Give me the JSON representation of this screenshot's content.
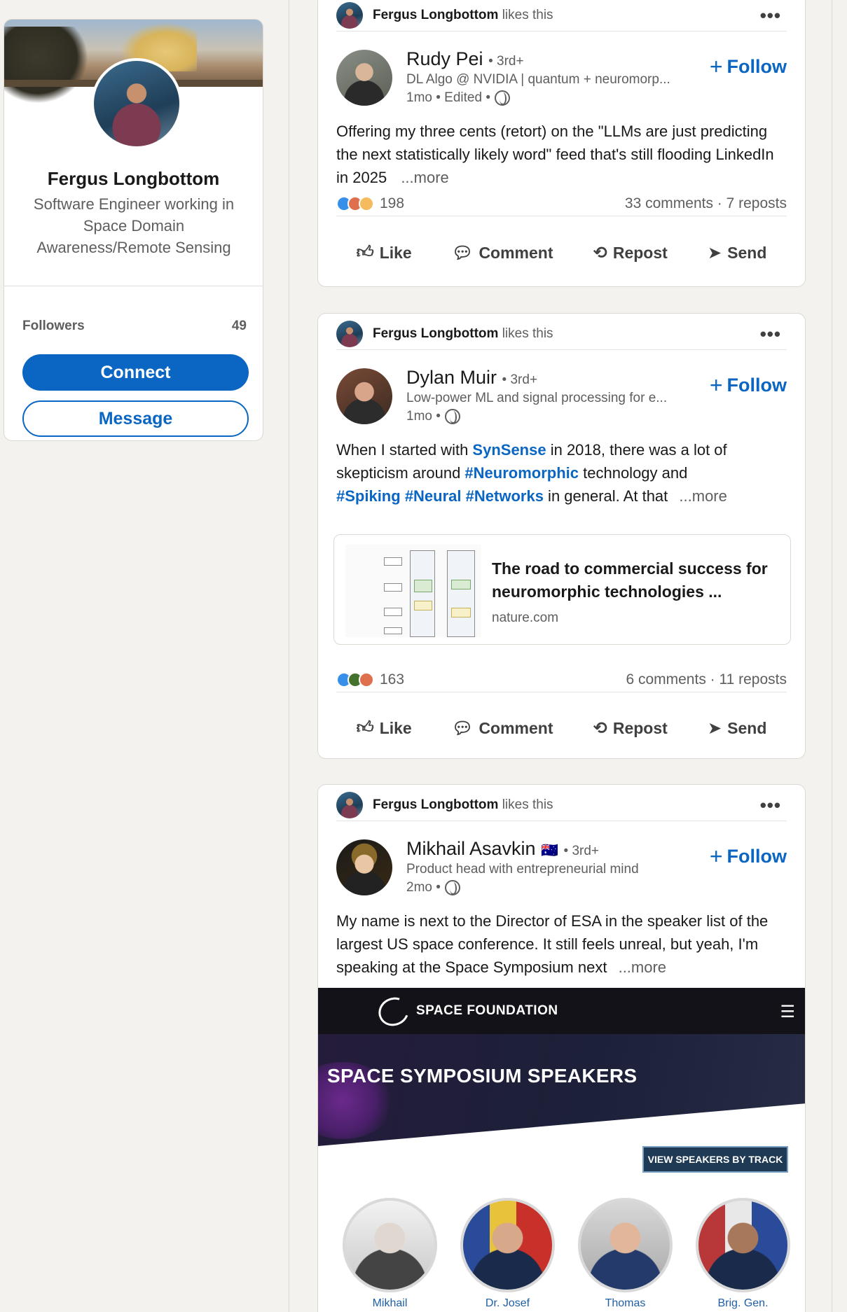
{
  "profile": {
    "name": "Fergus Longbottom",
    "headline": "Software Engineer working in Space Domain Awareness/Remote Sensing",
    "followers_label": "Followers",
    "followers_count": "49",
    "connect_label": "Connect",
    "message_label": "Message"
  },
  "common": {
    "likes_suffix": "likes this",
    "follow_label": "Follow",
    "follow_plus": "+",
    "more_icon": "more-horizontal-icon",
    "more_glyph": "•••",
    "actions": {
      "like": "Like",
      "comment": "Comment",
      "repost": "Repost",
      "send": "Send"
    }
  },
  "posts": [
    {
      "context_name": "Fergus Longbottom",
      "author_name": "Rudy Pei",
      "author_degree": "• 3rd+",
      "author_headline": "DL Algo @ NVIDIA | quantum + neuromorp...",
      "time": "1mo • Edited •",
      "text": "Offering my three cents (retort) on the \"LLMs are just predicting the next statistically likely word\" feed that's still flooding LinkedIn in 2025",
      "more": "...more",
      "reactions_count": "198",
      "comments_reposts": "33 comments · 7 reposts"
    },
    {
      "context_name": "Fergus Longbottom",
      "author_name": "Dylan Muir",
      "author_degree": "• 3rd+",
      "author_headline": "Low-power ML and signal processing for e...",
      "time": "1mo •",
      "text_parts": {
        "p1": "When I started with ",
        "link1": "SynSense",
        "p2": " in 2018, there was a lot of skepticism around ",
        "tag1": "#Neuromorphic",
        "p3": " technology and ",
        "tag2": "#Spiking",
        "tag3": "#Neural",
        "tag4": "#Networks",
        "p4": " in general. At that "
      },
      "more": "...more",
      "link_card": {
        "title": "The road to commercial success for neuromorphic technologies ...",
        "source": "nature.com"
      },
      "reactions_count": "163",
      "comments_reposts": "6 comments · 11 reposts"
    },
    {
      "context_name": "Fergus Longbottom",
      "author_name": "Mikhail Asavkin",
      "author_flag": "🇦🇺",
      "author_degree": "• 3rd+",
      "author_headline": "Product head with entrepreneurial mind",
      "time": "2mo •",
      "text": "My name is next to the Director of ESA in the speaker list of the largest US space conference. It still feels unreal, but yeah, I'm speaking at the Space Symposium next",
      "more": "...more",
      "image": {
        "logo_text": "SPACE FOUNDATION",
        "banner_title": "SPACE SYMPOSIUM SPEAKERS",
        "track_button": "VIEW SPEAKERS BY TRACK",
        "menu_icon": "hamburger-menu-icon",
        "speaker_names": [
          "Mikhail",
          "Dr. Josef",
          "Thomas",
          "Brig. Gen."
        ]
      }
    }
  ],
  "colors": {
    "accent": "#0a66c2",
    "page_bg": "#f4f2ee",
    "muted_text": "#5e5e5e"
  }
}
